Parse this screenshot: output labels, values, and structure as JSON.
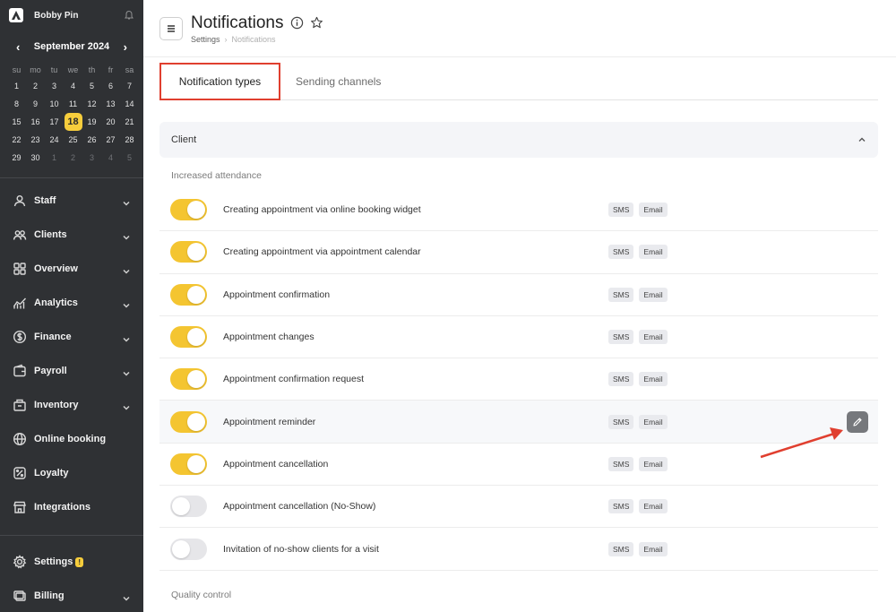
{
  "sidebar": {
    "user_name": "Bobby Pin",
    "calendar": {
      "month_label": "September 2024",
      "prev": "‹",
      "next": "›",
      "weekdays": [
        "su",
        "mo",
        "tu",
        "we",
        "th",
        "fr",
        "sa"
      ],
      "days": [
        [
          "1",
          "2",
          "3",
          "4",
          "5",
          "6",
          "7"
        ],
        [
          "8",
          "9",
          "10",
          "11",
          "12",
          "13",
          "14"
        ],
        [
          "15",
          "16",
          "17",
          "18",
          "19",
          "20",
          "21"
        ],
        [
          "22",
          "23",
          "24",
          "25",
          "26",
          "27",
          "28"
        ],
        [
          "29",
          "30",
          "1",
          "2",
          "3",
          "4",
          "5"
        ]
      ],
      "today": "18"
    },
    "nav": [
      {
        "label": "Staff",
        "icon": "user-icon"
      },
      {
        "label": "Clients",
        "icon": "users-icon"
      },
      {
        "label": "Overview",
        "icon": "grid-icon"
      },
      {
        "label": "Analytics",
        "icon": "chart-icon"
      },
      {
        "label": "Finance",
        "icon": "dollar-icon"
      },
      {
        "label": "Payroll",
        "icon": "wallet-icon"
      },
      {
        "label": "Inventory",
        "icon": "box-icon"
      },
      {
        "label": "Online booking",
        "icon": "globe-icon"
      },
      {
        "label": "Loyalty",
        "icon": "percent-icon"
      },
      {
        "label": "Integrations",
        "icon": "store-icon"
      }
    ],
    "settings_label": "Settings",
    "settings_badge": "!",
    "billing_label": "Billing"
  },
  "header": {
    "title": "Notifications",
    "breadcrumb": [
      "Settings",
      "Notifications"
    ]
  },
  "tabs": [
    {
      "label": "Notification types",
      "active": true
    },
    {
      "label": "Sending channels",
      "active": false
    }
  ],
  "section": {
    "title": "Client",
    "groups": [
      {
        "label": "Increased attendance",
        "items": [
          {
            "label": "Creating appointment via online booking widget",
            "enabled": true
          },
          {
            "label": "Creating appointment via appointment calendar",
            "enabled": true
          },
          {
            "label": "Appointment confirmation",
            "enabled": true
          },
          {
            "label": "Appointment changes",
            "enabled": true
          },
          {
            "label": "Appointment confirmation request",
            "enabled": true
          },
          {
            "label": "Appointment reminder",
            "enabled": true
          },
          {
            "label": "Appointment cancellation",
            "enabled": true
          },
          {
            "label": "Appointment cancellation (No-Show)",
            "enabled": false
          },
          {
            "label": "Invitation of no-show clients for a visit",
            "enabled": false
          }
        ]
      },
      {
        "label": "Quality control",
        "items": []
      }
    ],
    "channels": [
      "SMS",
      "Email"
    ]
  },
  "colors": {
    "accent_yellow": "#f4c531",
    "sidebar_bg": "#2f3134",
    "highlight_red": "#e03f2f"
  }
}
